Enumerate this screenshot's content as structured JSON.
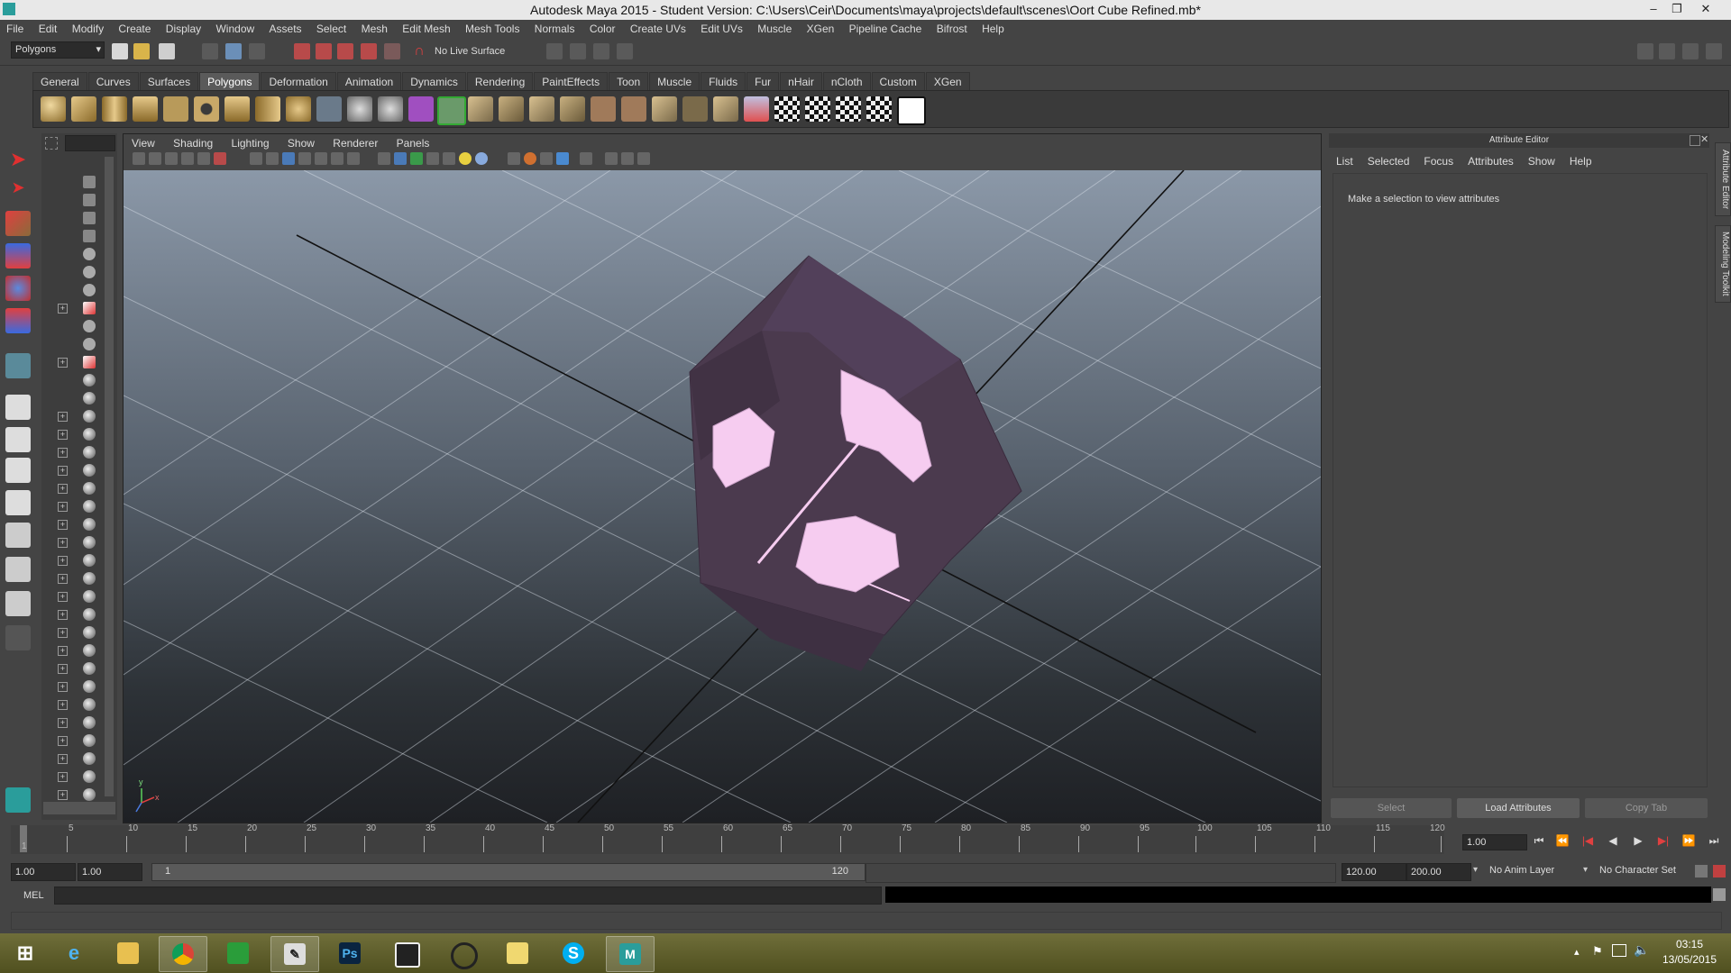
{
  "window": {
    "title": "Autodesk Maya 2015 - Student Version: C:\\Users\\Ceir\\Documents\\maya\\projects\\default\\scenes\\Oort Cube Refined.mb*",
    "controls": [
      "–",
      "❐",
      "✕"
    ]
  },
  "menubar": [
    "File",
    "Edit",
    "Modify",
    "Create",
    "Display",
    "Window",
    "Assets",
    "Select",
    "Mesh",
    "Edit Mesh",
    "Mesh Tools",
    "Normals",
    "Color",
    "Create UVs",
    "Edit UVs",
    "Muscle",
    "XGen",
    "Pipeline Cache",
    "Bifrost",
    "Help"
  ],
  "statusline": {
    "menuset": "Polygons",
    "live_surface": "No Live Surface"
  },
  "shelf": {
    "tabs": [
      "General",
      "Curves",
      "Surfaces",
      "Polygons",
      "Deformation",
      "Animation",
      "Dynamics",
      "Rendering",
      "PaintEffects",
      "Toon",
      "Muscle",
      "Fluids",
      "Fur",
      "nHair",
      "nCloth",
      "Custom",
      "XGen"
    ],
    "active_tab": "Polygons"
  },
  "viewport": {
    "menu": [
      "View",
      "Shading",
      "Lighting",
      "Show",
      "Renderer",
      "Panels"
    ],
    "axis_labels": {
      "y": "y",
      "x": "x"
    },
    "colors": {
      "mesh": "#4b3a4e",
      "highlight": "#f6ccf0"
    }
  },
  "attribute_editor": {
    "title": "Attribute Editor",
    "menu": [
      "List",
      "Selected",
      "Focus",
      "Attributes",
      "Show",
      "Help"
    ],
    "message": "Make a selection to view attributes",
    "buttons": {
      "select": "Select",
      "load": "Load Attributes",
      "copy": "Copy Tab"
    },
    "side_tabs": [
      "Attribute Editor",
      "Modeling Toolkit"
    ]
  },
  "timeline": {
    "ticks": [
      "1",
      "5",
      "10",
      "15",
      "20",
      "25",
      "30",
      "35",
      "40",
      "45",
      "50",
      "55",
      "60",
      "65",
      "70",
      "75",
      "80",
      "85",
      "90",
      "95",
      "100",
      "105",
      "110",
      "115",
      "120"
    ],
    "current_frame": "1.00",
    "playback": [
      "⏮",
      "⏪",
      "|◀",
      "◀",
      "▶",
      "▶|",
      "⏩",
      "⏭"
    ]
  },
  "range": {
    "start": "1.00",
    "playback_start": "1.00",
    "range_start_label": "1",
    "range_end_label": "120",
    "playback_end": "120.00",
    "end": "200.00",
    "anim_layer": "No Anim Layer",
    "character_set": "No Character Set"
  },
  "command": {
    "label": "MEL"
  },
  "taskbar": {
    "apps": [
      "windows",
      "internet-explorer",
      "file-explorer",
      "chrome",
      "store",
      "sketchbook",
      "photoshop",
      "movie-maker",
      "circle-app",
      "folder",
      "skype",
      "maya"
    ],
    "time": "03:15",
    "date": "13/05/2015"
  }
}
